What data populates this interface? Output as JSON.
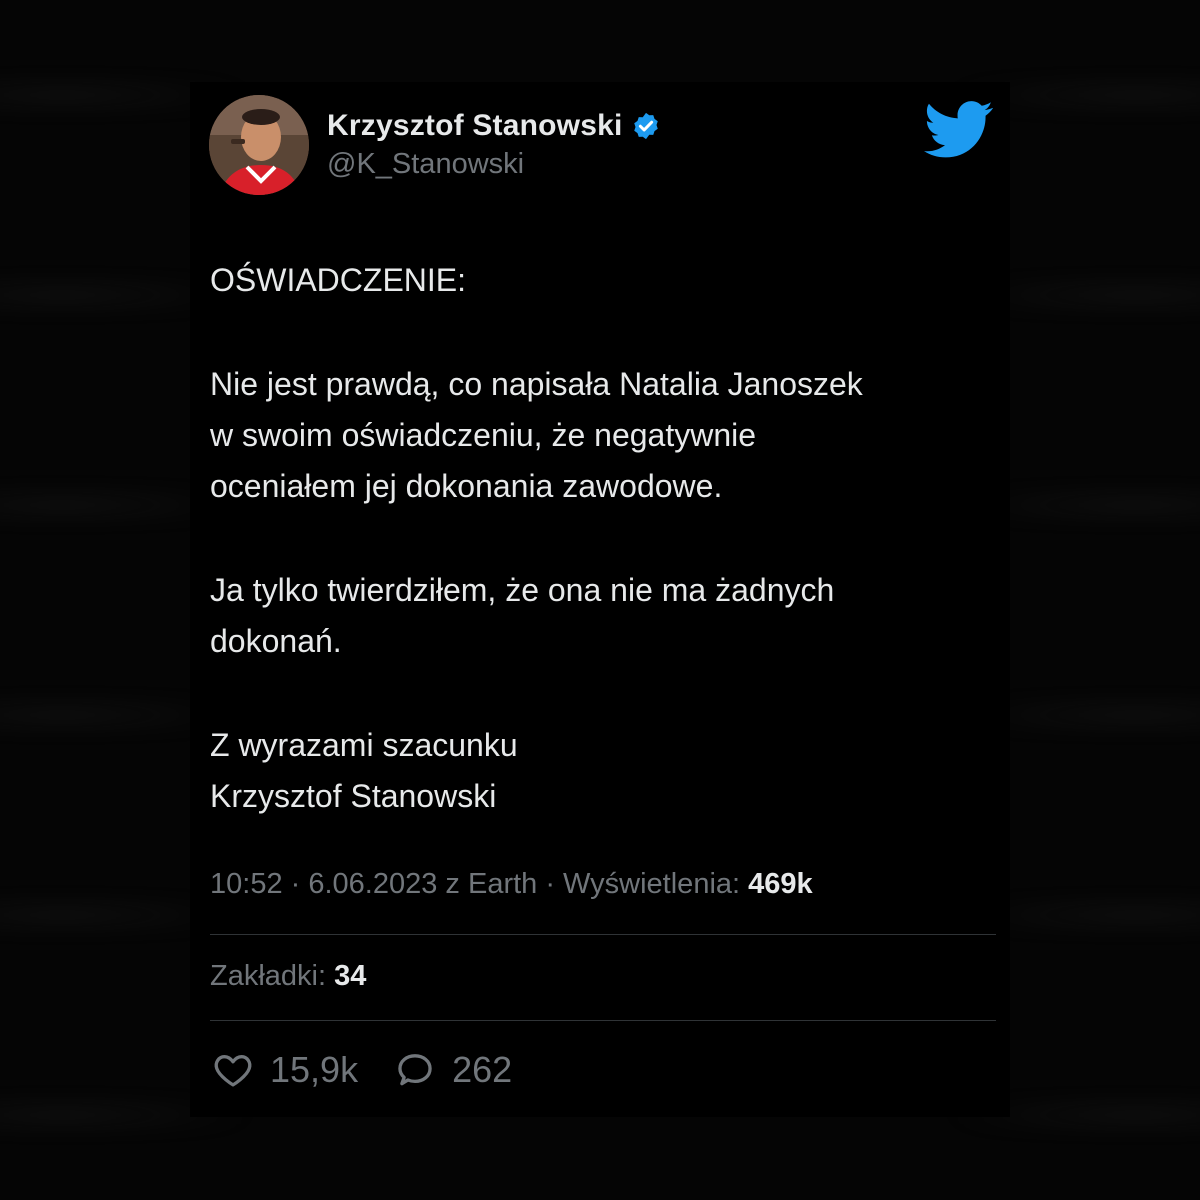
{
  "tweet": {
    "author": {
      "display_name": "Krzysztof Stanowski",
      "handle": "@K_Stanowski",
      "verified": true
    },
    "body": {
      "heading": "OŚWIADCZENIE:",
      "paragraph1_line1": "Nie jest prawdą, co napisała Natalia Janoszek",
      "paragraph1_line2": "w swoim oświadczeniu, że negatywnie",
      "paragraph1_line3": "oceniałem jej dokonania zawodowe.",
      "paragraph2_line1": "Ja tylko twierdziłem, że ona nie ma żadnych",
      "paragraph2_line2": "dokonań.",
      "closing_line1": "Z wyrazami szacunku",
      "closing_line2": "Krzysztof Stanowski"
    },
    "meta": {
      "time_date_source": "10:52 · 6.06.2023 z Earth · Wyświetlenia: ",
      "views": "469k"
    },
    "bookmarks": {
      "label": "Zakładki: ",
      "count": "34"
    },
    "actions": {
      "likes": "15,9k",
      "replies": "262"
    },
    "icons": {
      "platform": "twitter-bird-icon",
      "verified": "verified-badge-icon",
      "like": "heart-icon",
      "reply": "reply-bubble-icon"
    },
    "colors": {
      "background": "#000000",
      "text_primary": "#e7e9ea",
      "text_secondary": "#71767b",
      "accent": "#1d9bf0",
      "divider": "#2f3336"
    }
  }
}
